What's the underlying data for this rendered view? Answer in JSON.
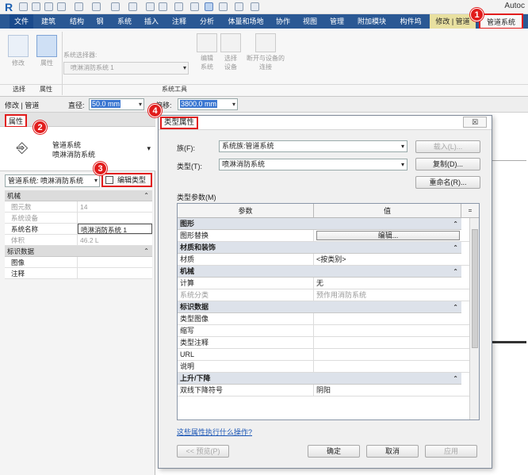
{
  "app": {
    "logo": "R",
    "title_partial": "Autoc"
  },
  "tabs": [
    {
      "label": "文件"
    },
    {
      "label": "建筑"
    },
    {
      "label": "结构"
    },
    {
      "label": "钢"
    },
    {
      "label": "系统"
    },
    {
      "label": "插入"
    },
    {
      "label": "注释"
    },
    {
      "label": "分析"
    },
    {
      "label": "体量和场地"
    },
    {
      "label": "协作"
    },
    {
      "label": "视图"
    },
    {
      "label": "管理"
    },
    {
      "label": "附加模块"
    },
    {
      "label": "构件坞"
    },
    {
      "label": "修改 | 管道"
    },
    {
      "label": "管道系统"
    }
  ],
  "ribbon": {
    "modify_label": "修改",
    "properties_label": "属性",
    "system_selector_label": "系统选择器:",
    "system_selector_value": "喷淋消防系统 1",
    "edit_system": "编辑\n系统",
    "select_equipment": "选择\n设备",
    "disconnect": "断开与设备的\n连接",
    "panel_select": "选择",
    "panel_properties": "属性",
    "panel_system_tools": "系统工具"
  },
  "optbar": {
    "context": "修改 | 管道",
    "diameter_label": "直径:",
    "diameter_value": "50.0 mm",
    "offset_label": "偏移:",
    "offset_value": "3800.0 mm"
  },
  "properties": {
    "title": "属性",
    "type_family": "管道系统",
    "type_name": "喷淋消防系统",
    "instance_selector": "管道系统: 喷淋消防系统",
    "edit_type_label": "编辑类型",
    "groups": [
      {
        "name": "机械",
        "rows": [
          {
            "key": "图元数",
            "value": "14",
            "readonly": true
          },
          {
            "key": "系统设备",
            "value": "",
            "readonly": true
          },
          {
            "key": "系统名称",
            "value": "喷淋消防系统 1",
            "readonly": false
          },
          {
            "key": "体积",
            "value": "46.2 L",
            "readonly": true
          }
        ]
      },
      {
        "name": "标识数据",
        "rows": [
          {
            "key": "图像",
            "value": "",
            "readonly": false
          },
          {
            "key": "注释",
            "value": "",
            "readonly": false
          }
        ]
      }
    ]
  },
  "badges": [
    "1",
    "2",
    "3",
    "4"
  ],
  "dialog": {
    "title": "类型属性",
    "close_label": "☒",
    "family_label": "族(F):",
    "family_value": "系统族:管道系统",
    "type_label": "类型(T):",
    "type_value": "喷淋消防系统",
    "load_label": "载入(L)...",
    "duplicate_label": "复制(D)...",
    "rename_label": "重命名(R)...",
    "type_params_label": "类型参数(M)",
    "col_param": "参数",
    "col_value": "值",
    "col_sym": "=",
    "groups": [
      {
        "name": "图形",
        "rows": [
          {
            "key": "图形替换",
            "value": "编辑...",
            "button": true
          }
        ]
      },
      {
        "name": "材质和装饰",
        "rows": [
          {
            "key": "材质",
            "value": "<按类别>"
          }
        ]
      },
      {
        "name": "机械",
        "rows": [
          {
            "key": "计算",
            "value": "无"
          },
          {
            "key": "系统分类",
            "value": "预作用消防系统",
            "readonly": true
          }
        ]
      },
      {
        "name": "标识数据",
        "rows": [
          {
            "key": "类型图像",
            "value": ""
          },
          {
            "key": "缩写",
            "value": ""
          },
          {
            "key": "类型注释",
            "value": ""
          },
          {
            "key": "URL",
            "value": ""
          },
          {
            "key": "说明",
            "value": ""
          }
        ]
      },
      {
        "name": "上升/下降",
        "rows": [
          {
            "key": "双线下降符号",
            "value": "阴阳"
          }
        ]
      }
    ],
    "help_link": "这些属性执行什么操作?",
    "preview_label": "<< 预览(P)",
    "ok_label": "确定",
    "cancel_label": "取消",
    "apply_label": "应用"
  },
  "colors": {
    "ribbon_tab_bg": "#2a5894",
    "highlight_red": "#e11c1c",
    "selection_blue": "#3a76d1"
  }
}
